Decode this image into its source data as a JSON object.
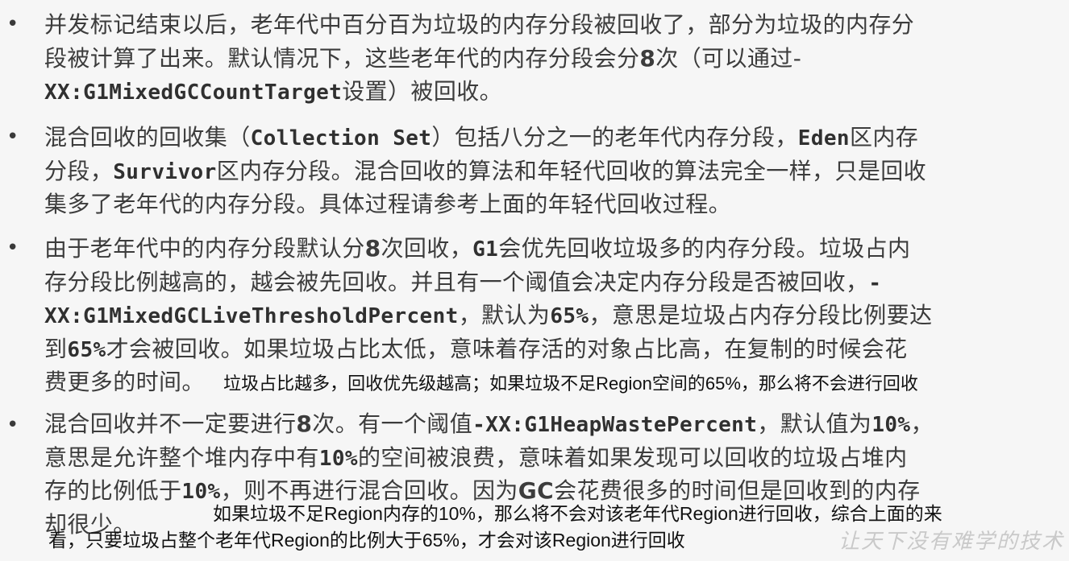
{
  "bullets": [
    {
      "lines": [
        [
          "并发标记结束以后，老年代中百分百为垃圾的内存分段被回收了，部分为垃圾的内存分"
        ],
        [
          "段被计算了出来。默认情况下，这些老年代的内存分段会分",
          "8",
          "次（可以通过-"
        ],
        [
          "XX:G1MixedGCCountTarget",
          "设置）被回收。"
        ]
      ]
    },
    {
      "lines": [
        [
          "混合回收的回收集（",
          "Collection Set",
          "）包括八分之一的老年代内存分段，",
          "Eden",
          "区内存"
        ],
        [
          "分段，",
          "Survivor",
          "区内存分段。混合回收的算法和年轻代回收的算法完全一样，只是回收"
        ],
        [
          "集多了老年代的内存分段。具体过程请参考上面的年轻代回收过程。"
        ]
      ]
    },
    {
      "lines": [
        [
          "由于老年代中的内存分段默认分",
          "8",
          "次回收，",
          "G1",
          "会优先回收垃圾多的内存分段。垃圾占内"
        ],
        [
          "存分段比例越高的，越会被先回收。并且有一个阈值会决定内存分段是否被回收，",
          "-"
        ],
        [
          "XX:G1MixedGCLiveThresholdPercent",
          "，默认为",
          "65%",
          "，意思是垃圾占内存分段比例要达"
        ],
        [
          "到",
          "65%",
          "才会被回收。如果垃圾占比太低，意味着存活的对象占比高，在复制的时候会花"
        ],
        [
          "费更多的时间。"
        ]
      ],
      "note": "垃圾占比越多，回收优先级越高；如果垃圾不足Region空间的65%，那么将不会进行回收"
    },
    {
      "lines": [
        [
          "混合回收并不一定要进行",
          "8",
          "次。有一个阈值",
          "-XX:G1HeapWastePercent",
          "，默认值为",
          "10%",
          "，"
        ],
        [
          "意思是允许整个堆内存中有",
          "10%",
          "的空间被浪费，意味着如果发现可以回收的垃圾占堆内"
        ],
        [
          "存的比例低于",
          "10%",
          "，则不再进行混合回收。因为",
          "GC",
          "会花费很多的时间但是回收到的内存"
        ],
        [
          "却很少。"
        ]
      ],
      "note_line1": "如果垃圾不足Region内存的10%，那么将不会对该老年代Region进行回收，综合上面的来",
      "note_line2": "看，只要垃圾占整个老年代Region的比例大于65%，才会对该Region进行回收"
    }
  ],
  "bullet_char": "•",
  "watermark": "让天下没有难学的技术"
}
